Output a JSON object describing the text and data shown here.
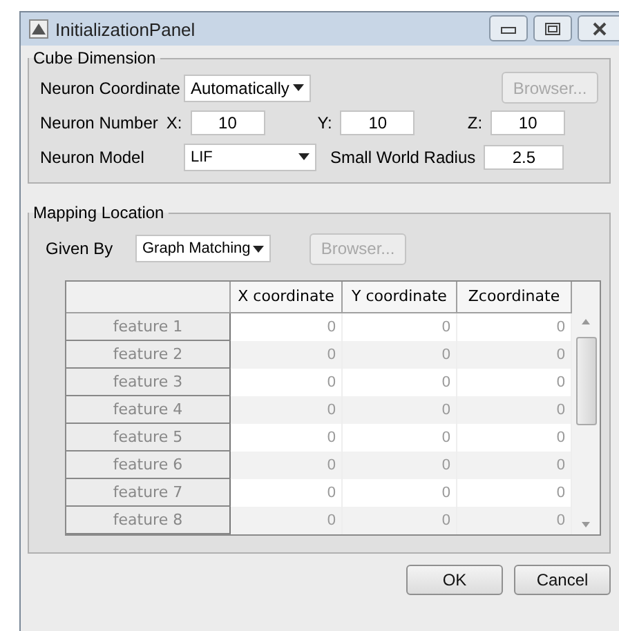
{
  "window": {
    "title": "InitializationPanel"
  },
  "cube_dimension": {
    "title": "Cube Dimension",
    "neuron_coordinate": {
      "label": "Neuron Coordinate",
      "value": "Automatically"
    },
    "browse_button": {
      "label": "Browser...",
      "disabled": true
    },
    "neuron_number": {
      "label": "Neuron Number",
      "fields": [
        {
          "label": "X:",
          "value": "10"
        },
        {
          "label": "Y:",
          "value": "10"
        },
        {
          "label": "Z:",
          "value": "10"
        }
      ]
    },
    "neuron_model": {
      "label": "Neuron Model",
      "value": "LIF"
    },
    "small_world_radius": {
      "label": "Small World Radius",
      "value": "2.5"
    }
  },
  "mapping_location": {
    "title": "Mapping Location",
    "given_by": {
      "label": "Given By",
      "value": "Graph Matching"
    },
    "browse_button": {
      "label": "Browser...",
      "disabled": true
    },
    "table": {
      "columns": [
        "X coordinate",
        "Y coordinate",
        "Zcoordinate"
      ],
      "rows": [
        {
          "name": "feature 1",
          "values": [
            "0",
            "0",
            "0"
          ]
        },
        {
          "name": "feature 2",
          "values": [
            "0",
            "0",
            "0"
          ]
        },
        {
          "name": "feature 3",
          "values": [
            "0",
            "0",
            "0"
          ]
        },
        {
          "name": "feature 4",
          "values": [
            "0",
            "0",
            "0"
          ]
        },
        {
          "name": "feature 5",
          "values": [
            "0",
            "0",
            "0"
          ]
        },
        {
          "name": "feature 6",
          "values": [
            "0",
            "0",
            "0"
          ]
        },
        {
          "name": "feature 7",
          "values": [
            "0",
            "0",
            "0"
          ]
        },
        {
          "name": "feature 8",
          "values": [
            "0",
            "0",
            "0"
          ]
        }
      ]
    }
  },
  "buttons": [
    "OK",
    "Cancel"
  ]
}
